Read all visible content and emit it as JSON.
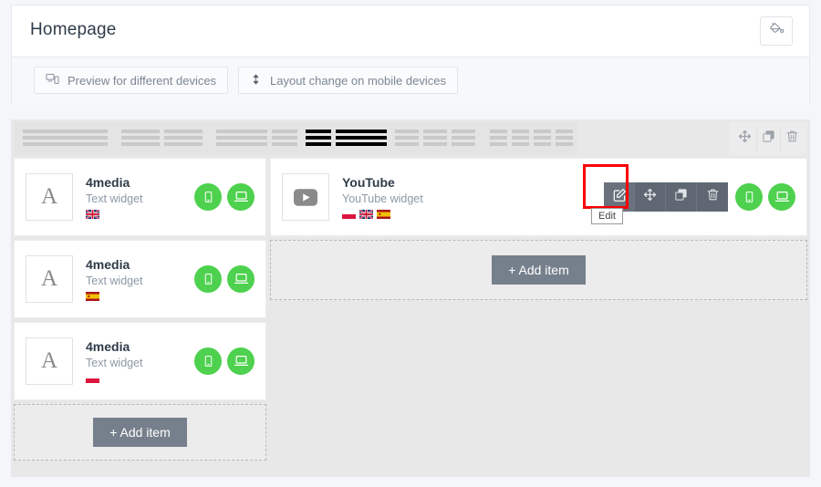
{
  "header": {
    "title": "Homepage",
    "fill_icon": "paint-bucket-icon",
    "buttons": [
      {
        "label": "Preview for different devices",
        "icon": "devices-icon"
      },
      {
        "label": "Layout change on mobile devices",
        "icon": "arrows-vertical-icon"
      }
    ]
  },
  "builder": {
    "layout_options": [
      {
        "id": "layout-1col",
        "active": false,
        "segments": [
          1
        ]
      },
      {
        "id": "layout-2col-equal",
        "active": false,
        "segments": [
          1,
          1
        ]
      },
      {
        "id": "layout-2col-wide-narrow",
        "active": false,
        "segments": [
          2,
          1
        ]
      },
      {
        "id": "layout-2col-narrow-wide",
        "active": true,
        "segments": [
          1,
          2
        ]
      },
      {
        "id": "layout-3col",
        "active": false,
        "segments": [
          1,
          1,
          1
        ]
      },
      {
        "id": "layout-4col",
        "active": false,
        "segments": [
          1,
          1,
          1,
          1
        ]
      }
    ],
    "row_tools": [
      {
        "label": "Move",
        "icon": "move-icon"
      },
      {
        "label": "Duplicate",
        "icon": "copy-icon"
      },
      {
        "label": "Delete",
        "icon": "trash-icon"
      }
    ],
    "left_column": {
      "widgets": [
        {
          "name": "4media",
          "type": "Text widget",
          "thumb_glyph": "A",
          "thumb_icon": "text-widget-icon",
          "flags": [
            "uk"
          ],
          "device_buttons": [
            {
              "label": "Mobile",
              "icon": "mobile-icon",
              "color": "#4ed14e"
            },
            {
              "label": "Desktop",
              "icon": "desktop-icon",
              "color": "#4ed14e"
            }
          ]
        },
        {
          "name": "4media",
          "type": "Text widget",
          "thumb_glyph": "A",
          "thumb_icon": "text-widget-icon",
          "flags": [
            "es"
          ],
          "device_buttons": [
            {
              "label": "Mobile",
              "icon": "mobile-icon",
              "color": "#4ed14e"
            },
            {
              "label": "Desktop",
              "icon": "desktop-icon",
              "color": "#4ed14e"
            }
          ]
        },
        {
          "name": "4media",
          "type": "Text widget",
          "thumb_glyph": "A",
          "thumb_icon": "text-widget-icon",
          "flags": [
            "pl"
          ],
          "device_buttons": [
            {
              "label": "Mobile",
              "icon": "mobile-icon",
              "color": "#4ed14e"
            },
            {
              "label": "Desktop",
              "icon": "desktop-icon",
              "color": "#4ed14e"
            }
          ]
        }
      ],
      "add_item_label": "+ Add item"
    },
    "right_column": {
      "widgets": [
        {
          "name": "YouTube",
          "type": "YouTube widget",
          "thumb_icon": "youtube-play-icon",
          "flags": [
            "pl",
            "uk",
            "es"
          ],
          "hover_tools": [
            {
              "label": "Edit",
              "icon": "pencil-square-icon",
              "active": true
            },
            {
              "label": "Move",
              "icon": "move-icon",
              "active": false
            },
            {
              "label": "Duplicate",
              "icon": "copy-icon",
              "active": false
            },
            {
              "label": "Delete",
              "icon": "trash-icon",
              "active": false
            }
          ],
          "device_buttons": [
            {
              "label": "Mobile",
              "icon": "mobile-icon",
              "color": "#4ed14e"
            },
            {
              "label": "Desktop",
              "icon": "desktop-icon",
              "color": "#4ed14e"
            }
          ]
        }
      ],
      "add_item_label": "+ Add item"
    }
  },
  "annotation": {
    "tooltip_text": "Edit",
    "highlight_color": "#fb0000",
    "highlight_target": "edit-button"
  }
}
